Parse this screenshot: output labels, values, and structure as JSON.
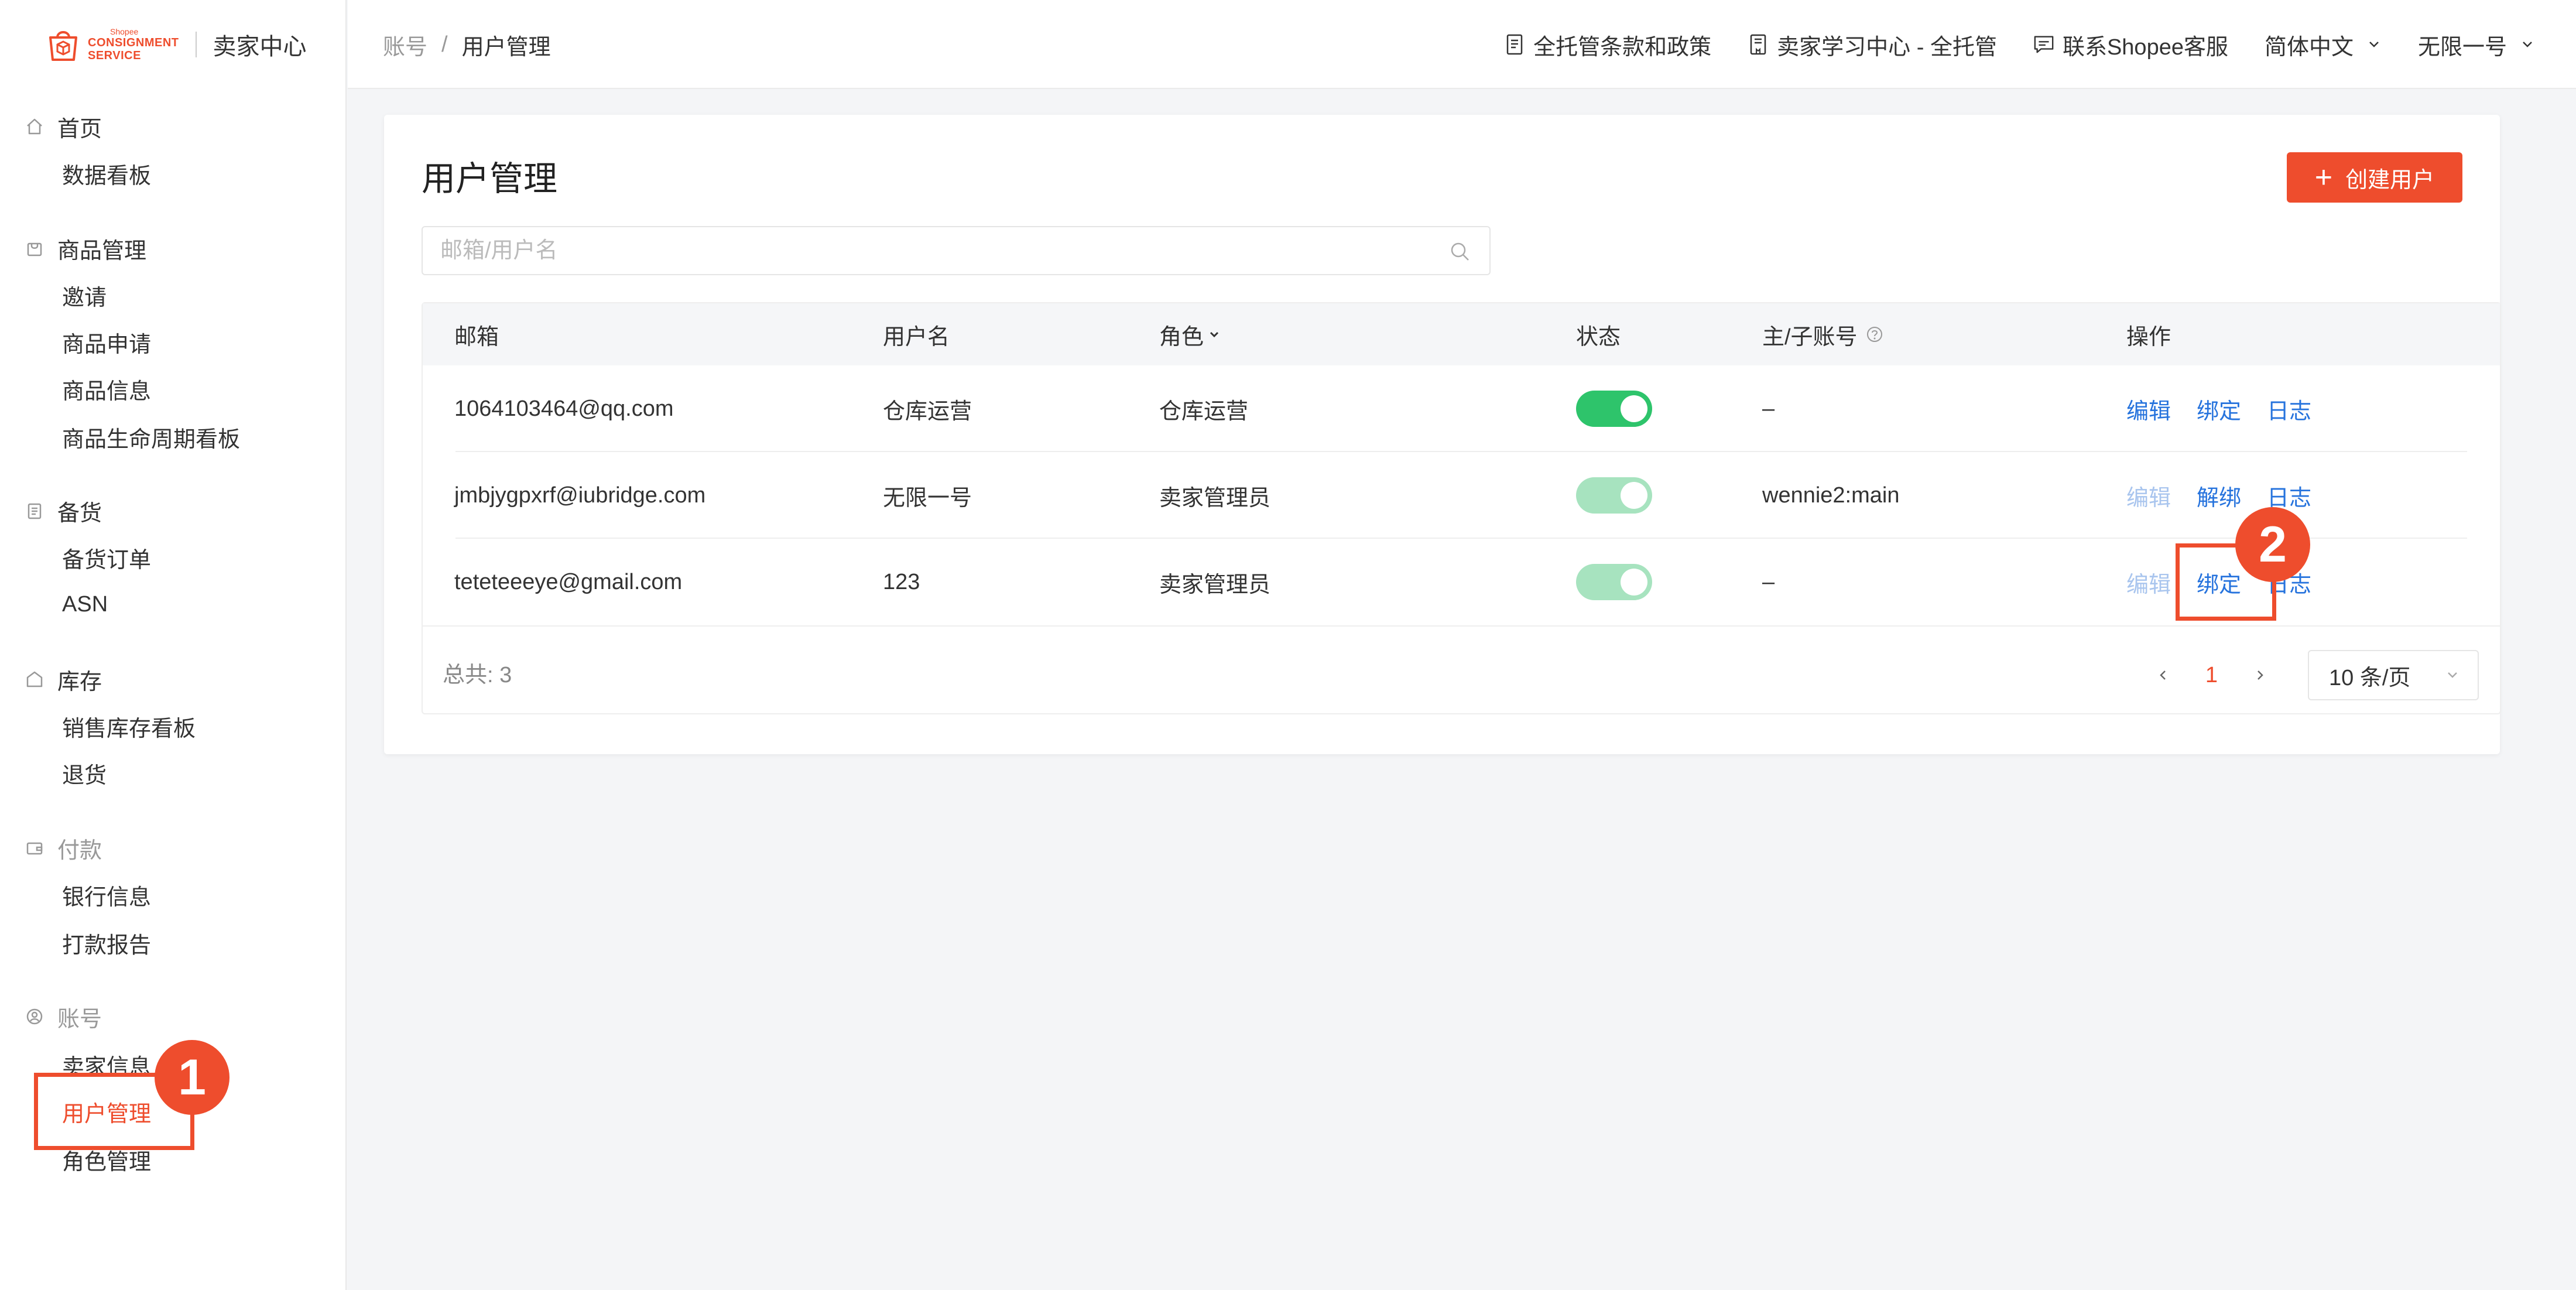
{
  "brand": {
    "line1": "Shopee",
    "line2": "CONSIGNMENT",
    "line3": "SERVICE",
    "title": "卖家中心",
    "color": "#ee4d2d"
  },
  "sidebar": {
    "groups": [
      {
        "label": "首页",
        "icon": "home-icon",
        "items": [
          "数据看板"
        ]
      },
      {
        "label": "商品管理",
        "icon": "bag-icon",
        "items": [
          "邀请",
          "商品申请",
          "商品信息",
          "商品生命周期看板"
        ]
      },
      {
        "label": "备货",
        "icon": "clipboard-icon",
        "items": [
          "备货订单",
          "ASN"
        ]
      },
      {
        "label": "库存",
        "icon": "warehouse-icon",
        "items": [
          "销售库存看板",
          "退货"
        ]
      },
      {
        "label": "付款",
        "icon": "wallet-icon",
        "items": [
          "银行信息",
          "打款报告"
        ]
      },
      {
        "label": "账号",
        "icon": "user-circle-icon",
        "items": [
          "卖家信息",
          "用户管理",
          "角色管理"
        ]
      }
    ],
    "active_item": "用户管理"
  },
  "topbar": {
    "breadcrumb": [
      "账号",
      "用户管理"
    ],
    "breadcrumb_sep": "/",
    "links": [
      {
        "label": "全托管条款和政策",
        "icon": "document-icon"
      },
      {
        "label": "卖家学习中心 - 全托管",
        "icon": "book-icon"
      },
      {
        "label": "联系Shopee客服",
        "icon": "chat-icon"
      }
    ],
    "language": "简体中文",
    "account": "无限一号"
  },
  "main": {
    "title": "用户管理",
    "create_button": "创建用户",
    "search_placeholder": "邮箱/用户名",
    "columns": {
      "email": "邮箱",
      "username": "用户名",
      "role": "角色",
      "status": "状态",
      "account_type": "主/子账号",
      "actions": "操作"
    },
    "rows": [
      {
        "email": "1064103464@qq.com",
        "username": "仓库运营",
        "role": "仓库运营",
        "status_on": true,
        "status_disabled": false,
        "account": "–",
        "actions": [
          "编辑",
          "绑定",
          "日志"
        ],
        "faded_edit": false
      },
      {
        "email": "jmbjygpxrf@iubridge.com",
        "username": "无限一号",
        "role": "卖家管理员",
        "status_on": true,
        "status_disabled": true,
        "account": "wennie2:main",
        "actions": [
          "编辑",
          "解绑",
          "日志"
        ],
        "faded_edit": true
      },
      {
        "email": "teteteeeye@gmail.com",
        "username": "123",
        "role": "卖家管理员",
        "status_on": true,
        "status_disabled": true,
        "account": "–",
        "actions": [
          "编辑",
          "绑定",
          "日志"
        ],
        "faded_edit": true
      }
    ],
    "total_label": "总共: 3",
    "current_page": "1",
    "page_size": "10 条/页"
  },
  "annotations": [
    {
      "number": "1"
    },
    {
      "number": "2"
    }
  ],
  "colors": {
    "accent": "#ee4d2d",
    "link": "#2673dd",
    "toggle_on": "#2ec46b",
    "toggle_disabled": "#a7e3bf"
  }
}
